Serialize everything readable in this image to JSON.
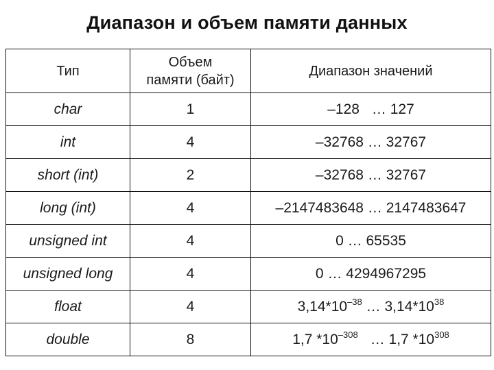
{
  "title": "Диапазон и объем памяти данных",
  "table": {
    "headers": {
      "type": "Тип",
      "size_line1": "Объем",
      "size_line2": "памяти (байт)",
      "range": "Диапазон значений"
    },
    "rows": [
      {
        "type": "char",
        "size": "1",
        "min": "–128",
        "sep": "…",
        "max": "127"
      },
      {
        "type": "int",
        "size": "4",
        "min": "–32768",
        "sep": "…",
        "max": "32767"
      },
      {
        "type": "short (int)",
        "size": "2",
        "min": "–32768",
        "sep": "…",
        "max": "32767"
      },
      {
        "type": "long (int)",
        "size": "4",
        "min": "–2147483648",
        "sep": "…",
        "max": "2147483647"
      },
      {
        "type": "unsigned int",
        "size": "4",
        "min": "0",
        "sep": "…",
        "max": "65535"
      },
      {
        "type": "unsigned long",
        "size": "4",
        "min": "0",
        "sep": "…",
        "max": "4294967295"
      },
      {
        "type": "float",
        "size": "4",
        "min_base": "3,14*10",
        "min_exp": "–38",
        "sep": "…",
        "max_base": "3,14*10",
        "max_exp": "38"
      },
      {
        "type": "double",
        "size": "8",
        "min_base": "1,7 *10",
        "min_exp": "–308",
        "sep": "…",
        "max_base": "1,7 *10",
        "max_exp": "308"
      }
    ]
  }
}
